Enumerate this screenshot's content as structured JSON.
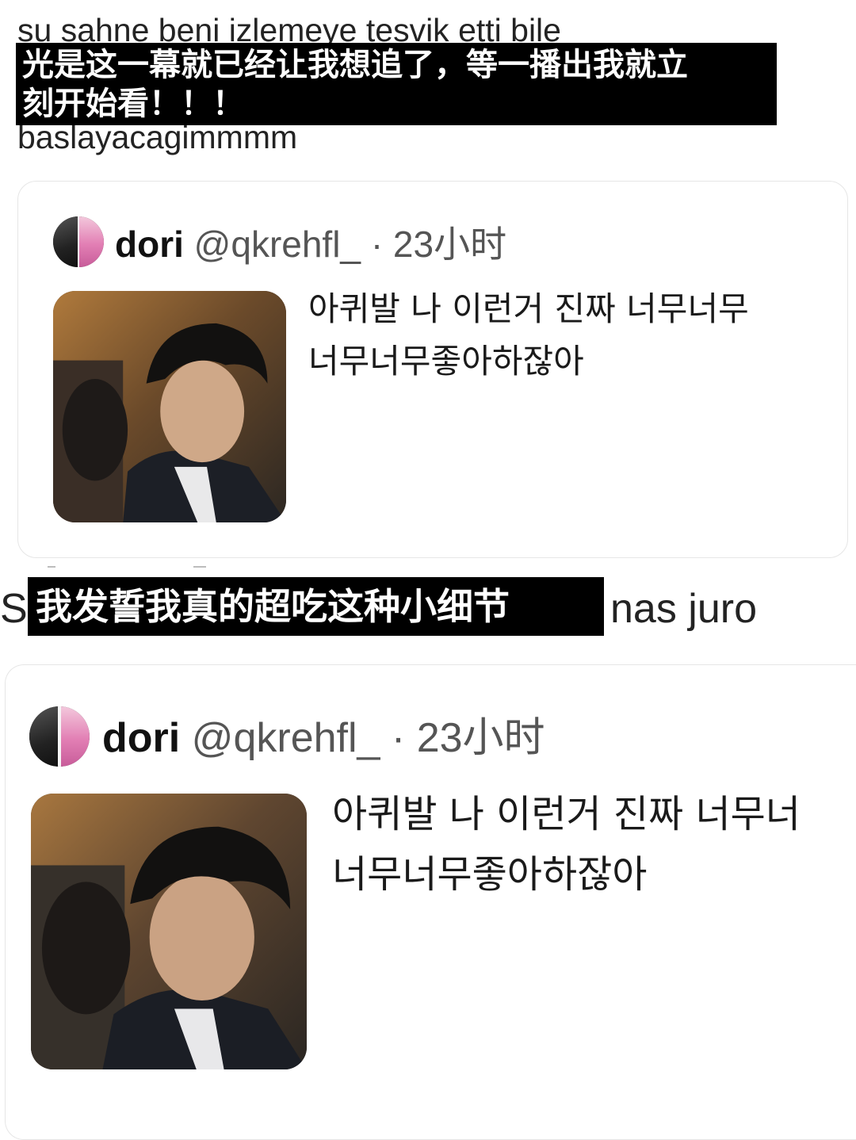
{
  "top_block": {
    "orig_line_1": "su sahne beni izlemeye tesvik etti bile",
    "subtitle_1_line_1": "光是这一幕就已经让我想追了，等一播出我就立",
    "subtitle_1_line_2": "刻开始看！！！",
    "orig_line_2": "baslayacagimmmm"
  },
  "middle_line": {
    "orig_left": "S",
    "subtitle_2": "我发誓我真的超吃这种小细节",
    "orig_right": "nas juro"
  },
  "tweets": [
    {
      "name": "dori",
      "handle": "@qkrehfl_",
      "dot": "·",
      "time": "23小时",
      "text_line_1": "아퀴발 나 이런거 진짜 너무너무",
      "text_line_2": "너무너무좋아하잖아"
    },
    {
      "name": "dori",
      "handle": "@qkrehfl_",
      "dot": "·",
      "time": "23小时",
      "text_line_1": "아퀴발 나 이런거 진짜 너무너",
      "text_line_2": "너무너무좋아하잖아"
    }
  ],
  "colors": {
    "subtitle_bg": "#000000",
    "subtitle_text": "#ffffff",
    "card_border": "#e6e6e6",
    "avatar_pink": "#e27fb4"
  },
  "icons": {
    "avatar": "avatar-image",
    "thumbnail": "video-thumbnail-image"
  }
}
